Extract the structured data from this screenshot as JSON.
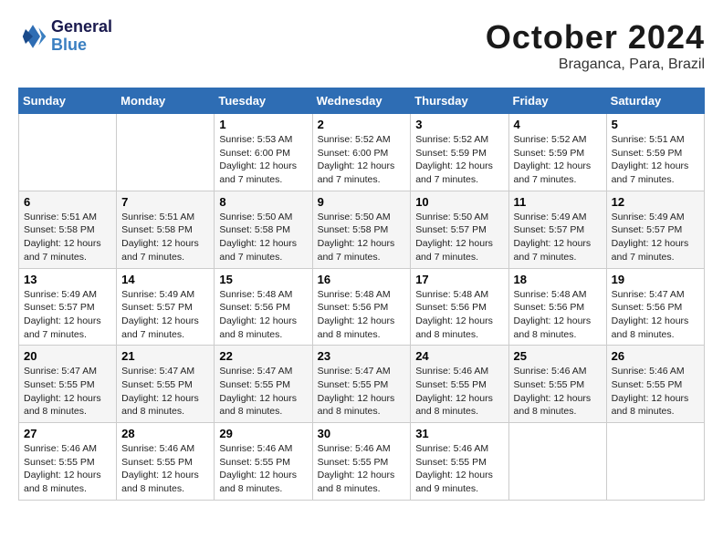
{
  "logo": {
    "line1": "General",
    "line2": "Blue"
  },
  "title": "October 2024",
  "location": "Braganca, Para, Brazil",
  "weekdays": [
    "Sunday",
    "Monday",
    "Tuesday",
    "Wednesday",
    "Thursday",
    "Friday",
    "Saturday"
  ],
  "weeks": [
    [
      {
        "day": "",
        "info": ""
      },
      {
        "day": "",
        "info": ""
      },
      {
        "day": "1",
        "info": "Sunrise: 5:53 AM\nSunset: 6:00 PM\nDaylight: 12 hours\nand 7 minutes."
      },
      {
        "day": "2",
        "info": "Sunrise: 5:52 AM\nSunset: 6:00 PM\nDaylight: 12 hours\nand 7 minutes."
      },
      {
        "day": "3",
        "info": "Sunrise: 5:52 AM\nSunset: 5:59 PM\nDaylight: 12 hours\nand 7 minutes."
      },
      {
        "day": "4",
        "info": "Sunrise: 5:52 AM\nSunset: 5:59 PM\nDaylight: 12 hours\nand 7 minutes."
      },
      {
        "day": "5",
        "info": "Sunrise: 5:51 AM\nSunset: 5:59 PM\nDaylight: 12 hours\nand 7 minutes."
      }
    ],
    [
      {
        "day": "6",
        "info": "Sunrise: 5:51 AM\nSunset: 5:58 PM\nDaylight: 12 hours\nand 7 minutes."
      },
      {
        "day": "7",
        "info": "Sunrise: 5:51 AM\nSunset: 5:58 PM\nDaylight: 12 hours\nand 7 minutes."
      },
      {
        "day": "8",
        "info": "Sunrise: 5:50 AM\nSunset: 5:58 PM\nDaylight: 12 hours\nand 7 minutes."
      },
      {
        "day": "9",
        "info": "Sunrise: 5:50 AM\nSunset: 5:58 PM\nDaylight: 12 hours\nand 7 minutes."
      },
      {
        "day": "10",
        "info": "Sunrise: 5:50 AM\nSunset: 5:57 PM\nDaylight: 12 hours\nand 7 minutes."
      },
      {
        "day": "11",
        "info": "Sunrise: 5:49 AM\nSunset: 5:57 PM\nDaylight: 12 hours\nand 7 minutes."
      },
      {
        "day": "12",
        "info": "Sunrise: 5:49 AM\nSunset: 5:57 PM\nDaylight: 12 hours\nand 7 minutes."
      }
    ],
    [
      {
        "day": "13",
        "info": "Sunrise: 5:49 AM\nSunset: 5:57 PM\nDaylight: 12 hours\nand 7 minutes."
      },
      {
        "day": "14",
        "info": "Sunrise: 5:49 AM\nSunset: 5:57 PM\nDaylight: 12 hours\nand 7 minutes."
      },
      {
        "day": "15",
        "info": "Sunrise: 5:48 AM\nSunset: 5:56 PM\nDaylight: 12 hours\nand 8 minutes."
      },
      {
        "day": "16",
        "info": "Sunrise: 5:48 AM\nSunset: 5:56 PM\nDaylight: 12 hours\nand 8 minutes."
      },
      {
        "day": "17",
        "info": "Sunrise: 5:48 AM\nSunset: 5:56 PM\nDaylight: 12 hours\nand 8 minutes."
      },
      {
        "day": "18",
        "info": "Sunrise: 5:48 AM\nSunset: 5:56 PM\nDaylight: 12 hours\nand 8 minutes."
      },
      {
        "day": "19",
        "info": "Sunrise: 5:47 AM\nSunset: 5:56 PM\nDaylight: 12 hours\nand 8 minutes."
      }
    ],
    [
      {
        "day": "20",
        "info": "Sunrise: 5:47 AM\nSunset: 5:55 PM\nDaylight: 12 hours\nand 8 minutes."
      },
      {
        "day": "21",
        "info": "Sunrise: 5:47 AM\nSunset: 5:55 PM\nDaylight: 12 hours\nand 8 minutes."
      },
      {
        "day": "22",
        "info": "Sunrise: 5:47 AM\nSunset: 5:55 PM\nDaylight: 12 hours\nand 8 minutes."
      },
      {
        "day": "23",
        "info": "Sunrise: 5:47 AM\nSunset: 5:55 PM\nDaylight: 12 hours\nand 8 minutes."
      },
      {
        "day": "24",
        "info": "Sunrise: 5:46 AM\nSunset: 5:55 PM\nDaylight: 12 hours\nand 8 minutes."
      },
      {
        "day": "25",
        "info": "Sunrise: 5:46 AM\nSunset: 5:55 PM\nDaylight: 12 hours\nand 8 minutes."
      },
      {
        "day": "26",
        "info": "Sunrise: 5:46 AM\nSunset: 5:55 PM\nDaylight: 12 hours\nand 8 minutes."
      }
    ],
    [
      {
        "day": "27",
        "info": "Sunrise: 5:46 AM\nSunset: 5:55 PM\nDaylight: 12 hours\nand 8 minutes."
      },
      {
        "day": "28",
        "info": "Sunrise: 5:46 AM\nSunset: 5:55 PM\nDaylight: 12 hours\nand 8 minutes."
      },
      {
        "day": "29",
        "info": "Sunrise: 5:46 AM\nSunset: 5:55 PM\nDaylight: 12 hours\nand 8 minutes."
      },
      {
        "day": "30",
        "info": "Sunrise: 5:46 AM\nSunset: 5:55 PM\nDaylight: 12 hours\nand 8 minutes."
      },
      {
        "day": "31",
        "info": "Sunrise: 5:46 AM\nSunset: 5:55 PM\nDaylight: 12 hours\nand 9 minutes."
      },
      {
        "day": "",
        "info": ""
      },
      {
        "day": "",
        "info": ""
      }
    ]
  ]
}
